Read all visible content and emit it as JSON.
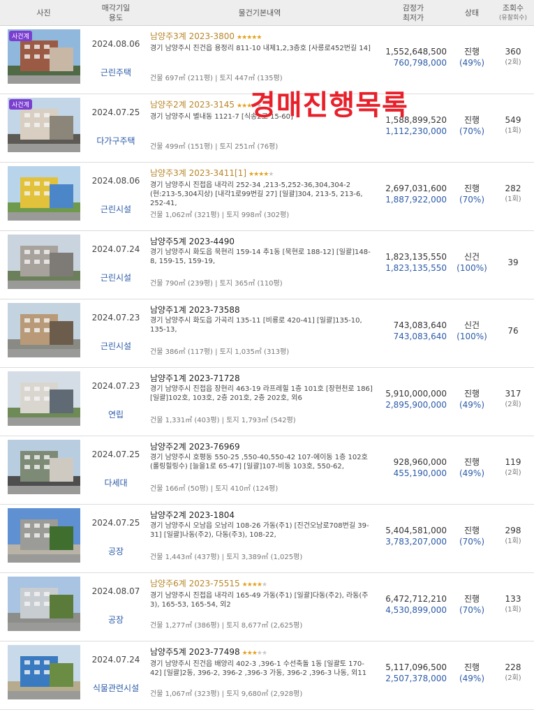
{
  "header": {
    "photo": "사진",
    "date_line1": "매각기일",
    "date_line2": "용도",
    "info": "물건기본내역",
    "price_line1": "감정가",
    "price_line2": "최저가",
    "status": "상태",
    "views_line1": "조회수",
    "views_line2": "(유찰회수)"
  },
  "watermark": "경매진행목록",
  "rows": [
    {
      "visit_badge": "사건계",
      "date": "2024.08.06",
      "usage": "근린주택",
      "case": "남양주3계 2023-3800",
      "rating": 5,
      "highlight": true,
      "address": "경기 남양주시 진건읍 용정리 811-10 내제1,2,3층호 [사릉로452번길 14]",
      "area": "건물 697㎡ (211평)  |  토지 447㎡ (135평)",
      "appraisal": "1,552,648,500",
      "minimum": "760,798,000",
      "status": "진행",
      "pct": "(49%)",
      "views": "360",
      "fails": "(2회)"
    },
    {
      "visit_badge": "사건계",
      "date": "2024.07.25",
      "usage": "다가구주택",
      "case": "남양주2계 2023-3145",
      "rating": 3,
      "highlight": true,
      "address": "경기 남양주시 별내동 1121-7 [식송2로 15-60]",
      "area": "건물 499㎡ (151평)  |  토지 251㎡ (76평)",
      "appraisal": "1,588,899,520",
      "minimum": "1,112,230,000",
      "status": "진행",
      "pct": "(70%)",
      "views": "549",
      "fails": "(1회)"
    },
    {
      "visit_badge": "",
      "date": "2024.08.06",
      "usage": "근린시설",
      "case": "남양주3계 2023-3411[1]",
      "rating": 4,
      "highlight": true,
      "address": "경기 남양주시 진접읍 내각리 252-34 ,213-5,252-36,304,304-2 (현:213-5,304지상) [내각1로99번길 27] [일괄]304, 213-5, 213-6, 252-41,",
      "area": "건물 1,062㎡ (321평)  |  토지 998㎡ (302평)",
      "appraisal": "2,697,031,600",
      "minimum": "1,887,922,000",
      "status": "진행",
      "pct": "(70%)",
      "views": "282",
      "fails": "(1회)"
    },
    {
      "visit_badge": "",
      "date": "2024.07.24",
      "usage": "근린시설",
      "case": "남양주5계 2023-4490",
      "rating": 0,
      "highlight": false,
      "address": "경기 남양주시 화도읍 묵현리 159-14 추1동 [묵현로 188-12] [일괄]148-8, 159-15, 159-19,",
      "area": "건물 790㎡ (239평)  |  토지 365㎡ (110평)",
      "appraisal": "1,823,135,550",
      "minimum": "1,823,135,550",
      "status": "신건",
      "pct": "(100%)",
      "views": "39",
      "fails": ""
    },
    {
      "visit_badge": "",
      "date": "2024.07.23",
      "usage": "근린시설",
      "case": "남양주1계 2023-73588",
      "rating": 0,
      "highlight": false,
      "address": "경기 남양주시 화도읍 가곡리 135-11 [비룡로 420-41] [일괄]135-10, 135-13,",
      "area": "건물 386㎡ (117평)  |  토지 1,035㎡ (313평)",
      "appraisal": "743,083,640",
      "minimum": "743,083,640",
      "status": "신건",
      "pct": "(100%)",
      "views": "76",
      "fails": ""
    },
    {
      "visit_badge": "",
      "date": "2024.07.23",
      "usage": "연립",
      "case": "남양주1계 2023-71728",
      "rating": 0,
      "highlight": false,
      "address": "경기 남양주시 진접읍 장현리 463-19 라프레힐 1층 101호 [장현천로 186] [일괄]102호, 103호, 2층 201호, 2층 202호, 외6",
      "area": "건물 1,331㎡ (403평)  |  토지 1,793㎡ (542평)",
      "appraisal": "5,910,000,000",
      "minimum": "2,895,900,000",
      "status": "진행",
      "pct": "(49%)",
      "views": "317",
      "fails": "(2회)"
    },
    {
      "visit_badge": "",
      "date": "2024.07.25",
      "usage": "다세대",
      "case": "남양주2계 2023-76969",
      "rating": 0,
      "highlight": false,
      "address": "경기 남양주시 호평동 550-25 ,550-40,550-42 107-에이동 1층 102호 (롤링힐링수) [늘을1로 65-47] [일괄]107-비동 103호, 550-62,",
      "area": "건물 166㎡ (50평)  |  토지 410㎡ (124평)",
      "appraisal": "928,960,000",
      "minimum": "455,190,000",
      "status": "진행",
      "pct": "(49%)",
      "views": "119",
      "fails": "(2회)"
    },
    {
      "visit_badge": "",
      "date": "2024.07.25",
      "usage": "공장",
      "case": "남양주2계 2023-1804",
      "rating": 0,
      "highlight": false,
      "address": "경기 남양주시 오남읍 오남리 108-26 가동(주1) [진건오남로708번길 39-31] [일괄]나동(주2), 다동(주3), 108-22,",
      "area": "건물 1,443㎡ (437평)  |  토지 3,389㎡ (1,025평)",
      "appraisal": "5,404,581,000",
      "minimum": "3,783,207,000",
      "status": "진행",
      "pct": "(70%)",
      "views": "298",
      "fails": "(1회)"
    },
    {
      "visit_badge": "",
      "date": "2024.08.07",
      "usage": "공장",
      "case": "남양주6계 2023-75515",
      "rating": 4,
      "highlight": true,
      "address": "경기 남양주시 진접읍 내각리 165-49 가동(주1) [일괄]다동(주2), 라동(주3), 165-53, 165-54, 외2",
      "area": "건물 1,277㎡ (386평)  |  토지 8,677㎡ (2,625평)",
      "appraisal": "6,472,712,210",
      "minimum": "4,530,899,000",
      "status": "진행",
      "pct": "(70%)",
      "views": "133",
      "fails": "(1회)"
    },
    {
      "visit_badge": "",
      "date": "2024.07.24",
      "usage": "식물관련시설",
      "case": "남양주5계 2023-77498",
      "rating": 3,
      "highlight": false,
      "address": "경기 남양주시 진건읍 배양리 402-3 ,396-1 수선축돌 1동 [일괄토 170-42] [일괄]2동, 396-2, 396-2 ,396-3 가동, 396-2 ,396-3 나동, 외11",
      "area": "건물 1,067㎡ (323평)  |  토지 9,680㎡ (2,928평)",
      "appraisal": "5,117,096,500",
      "minimum": "2,507,378,000",
      "status": "진행",
      "pct": "(49%)",
      "views": "228",
      "fails": "(2회)"
    }
  ],
  "colors": {
    "header_bg": "#eeeeee",
    "link_blue": "#2b5aa8",
    "highlight_gold": "#b8862a",
    "star_on": "#e4a11b",
    "watermark_red": "#e8202a",
    "visit_badge": "#7b3fd0"
  }
}
